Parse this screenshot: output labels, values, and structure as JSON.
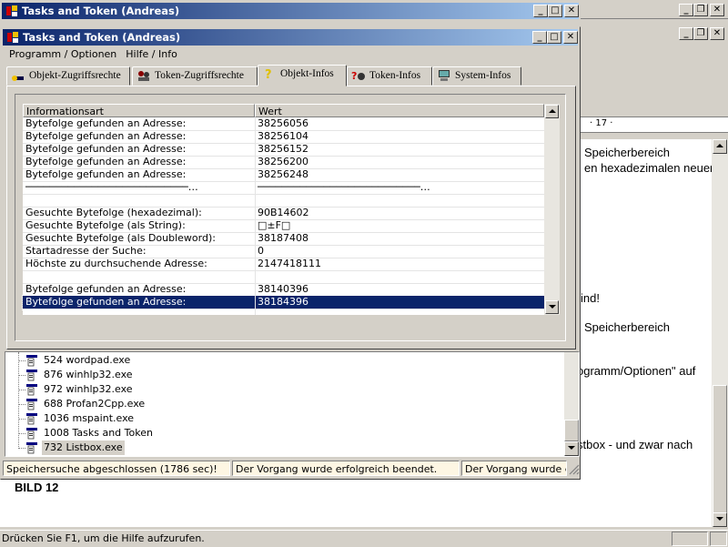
{
  "background_window": {
    "text_lines": [
      "Speicherbereich",
      "en hexadezimalen neuen",
      "ind!",
      "Speicherbereich",
      "ogramm/Optionen\" auf",
      "stbox - und zwar nach"
    ],
    "caption": "BILD 12",
    "status_text": "Drücken Sie F1, um die Hilfe aufzurufen.",
    "ruler_text": "· 17 ·"
  },
  "back_window": {
    "title": "Tasks and Token  (Andreas)"
  },
  "main_window": {
    "title": "Tasks and Token  (Andreas)",
    "menu": [
      "Programm / Optionen",
      "Hilfe / Info"
    ],
    "tabs": [
      "Objekt-Zugriffsrechte",
      "Token-Zugriffsrechte",
      "Objekt-Infos",
      "Token-Infos",
      "System-Infos"
    ],
    "active_tab": "Objekt-Infos",
    "table": {
      "headers": [
        "Informationsart",
        "Wert"
      ],
      "rows": [
        {
          "c1": "Bytefolge gefunden an Adresse:",
          "c2": "38256056"
        },
        {
          "c1": "Bytefolge gefunden an Adresse:",
          "c2": "38256104"
        },
        {
          "c1": "Bytefolge gefunden an Adresse:",
          "c2": "38256152"
        },
        {
          "c1": "Bytefolge gefunden an Adresse:",
          "c2": "38256200"
        },
        {
          "c1": "Bytefolge gefunden an Adresse:",
          "c2": "38256248"
        },
        {
          "c1": "───────────────────────────…",
          "c2": "───────────────────────────…"
        },
        {
          "c1": "",
          "c2": ""
        },
        {
          "c1": "Gesuchte Bytefolge (hexadezimal):",
          "c2": "90B14602"
        },
        {
          "c1": "Gesuchte Bytefolge (als String):",
          "c2": "□±F□"
        },
        {
          "c1": "Gesuchte Bytefolge (als Doubleword):",
          "c2": "38187408"
        },
        {
          "c1": "Startadresse der Suche:",
          "c2": "0"
        },
        {
          "c1": "Höchste zu durchsuchende Adresse:",
          "c2": "2147418111"
        },
        {
          "c1": "",
          "c2": ""
        },
        {
          "c1": "Bytefolge gefunden an Adresse:",
          "c2": "38140396"
        },
        {
          "c1": "Bytefolge gefunden an Adresse:",
          "c2": "38184396"
        }
      ],
      "selected_row": 14
    },
    "process_list": [
      "524 wordpad.exe",
      "876 winhlp32.exe",
      "972 winhlp32.exe",
      "688 Profan2Cpp.exe",
      "1036 mspaint.exe",
      "1008 Tasks and Token",
      "732 Listbox.exe"
    ],
    "status": [
      "Speichersuche abgeschlossen (1786 sec)!",
      "Der Vorgang wurde erfolgreich beendet.",
      "Der Vorgang wurde erfolgreich beendet."
    ]
  },
  "colors": {
    "selection": "#0a246a",
    "face": "#d4d0c8"
  }
}
